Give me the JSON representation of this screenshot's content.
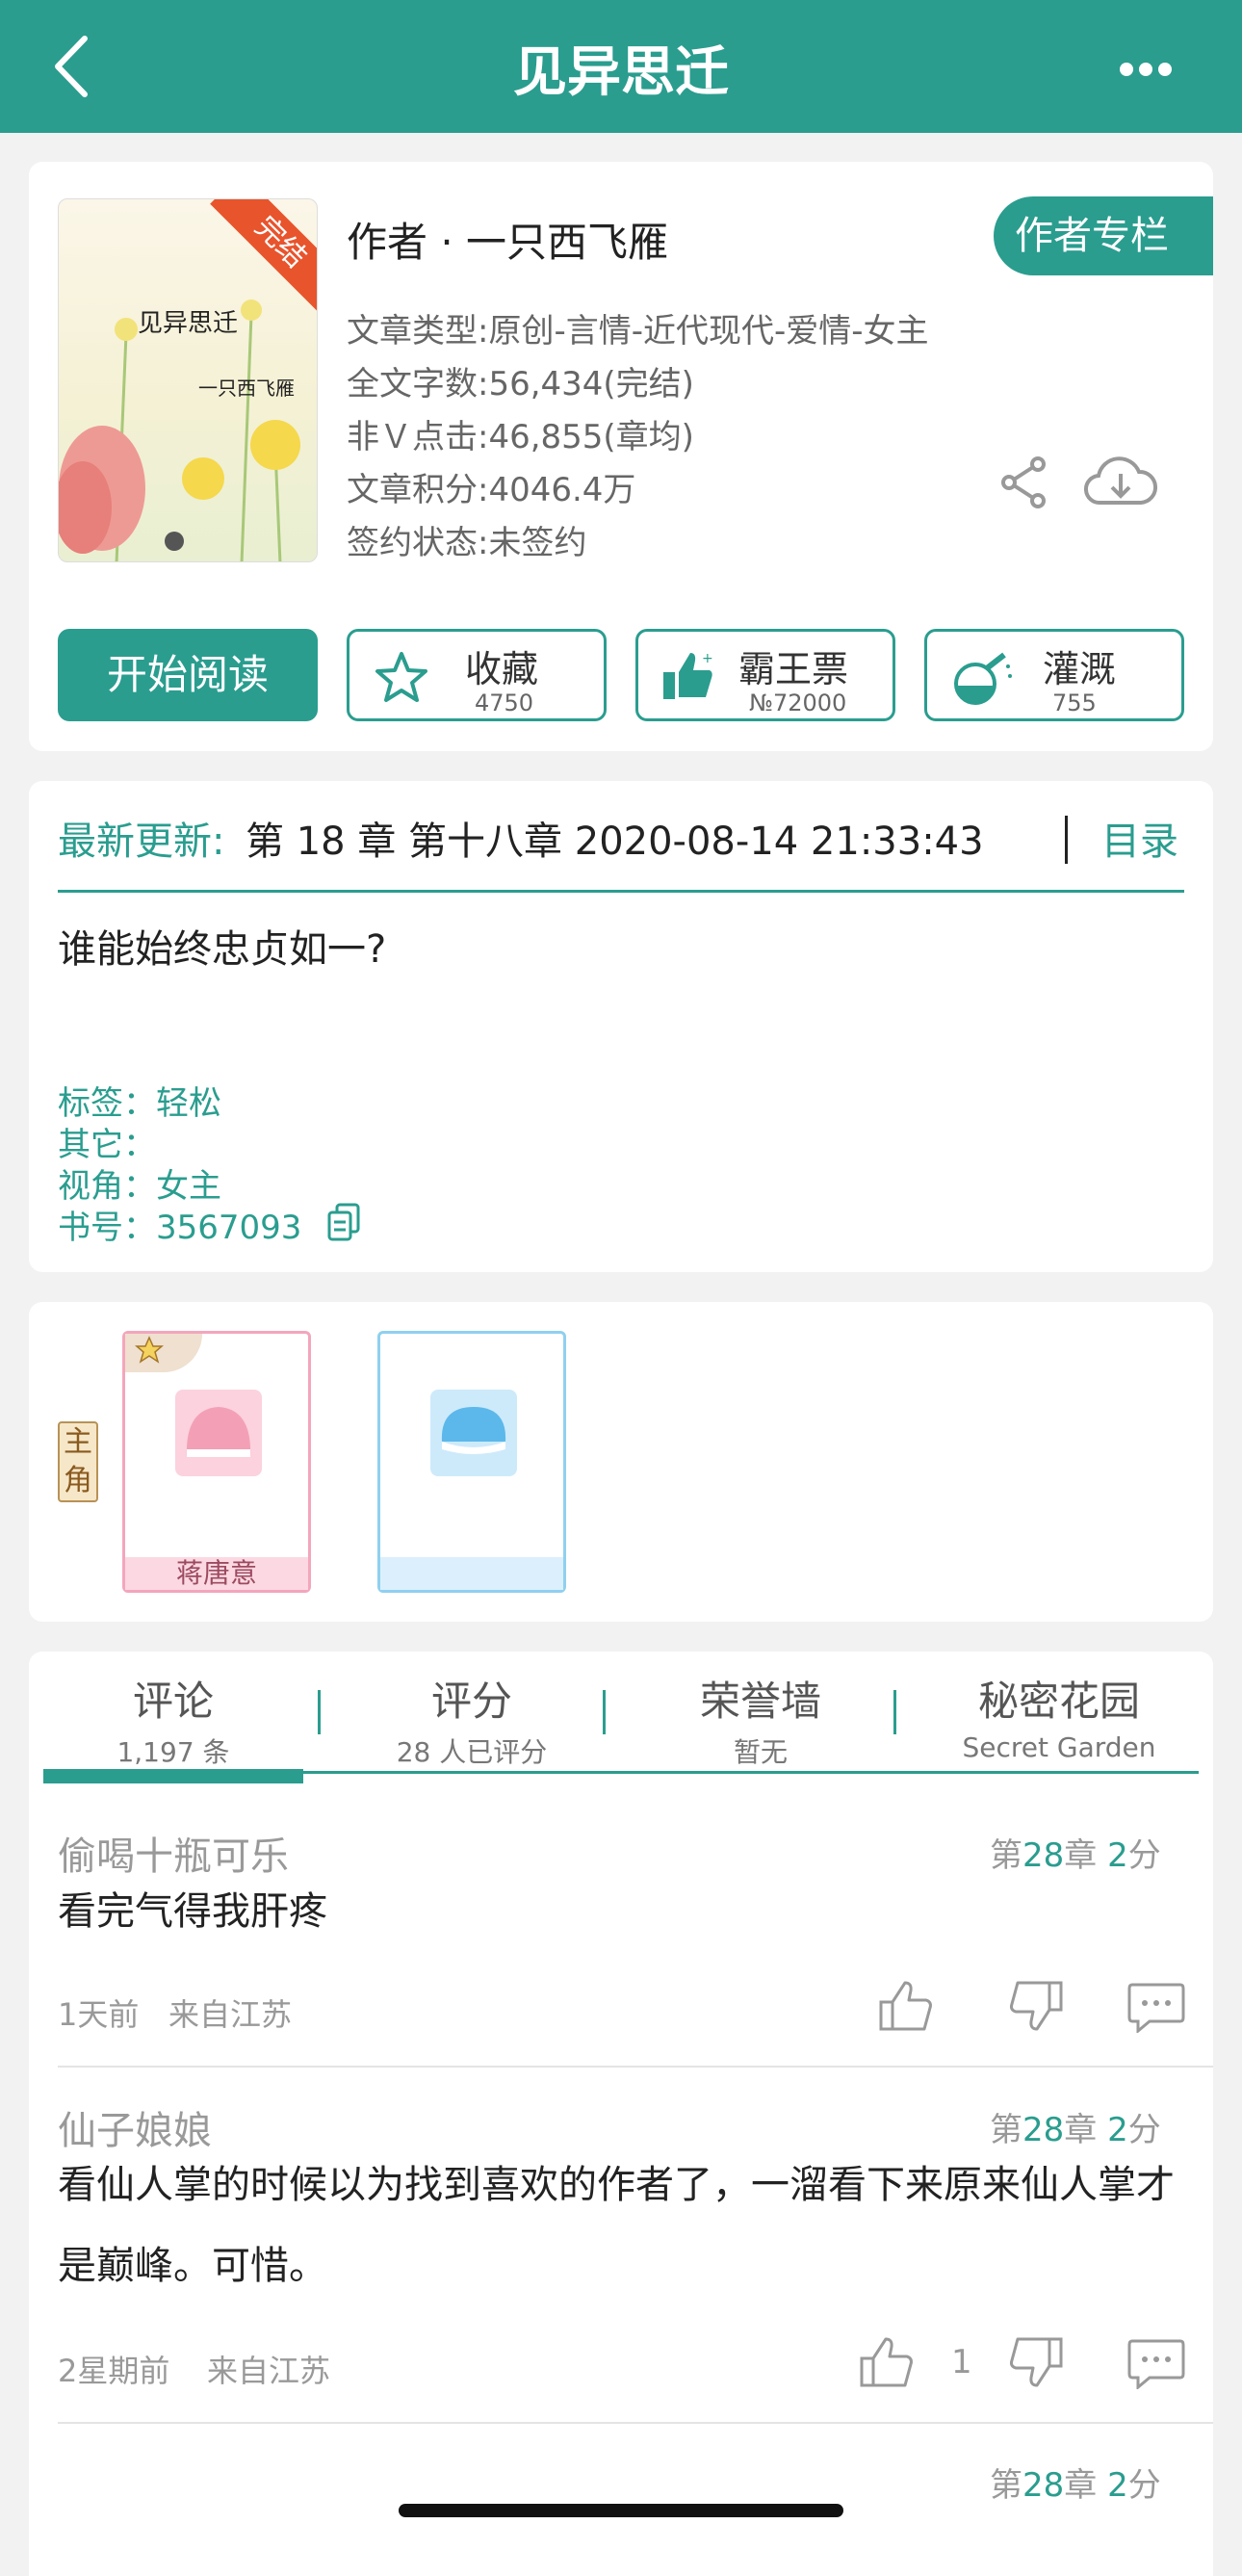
{
  "header": {
    "title": "见异思迁"
  },
  "book": {
    "cover_title": "见异思迁",
    "cover_author": "一只西飞雁",
    "cover_badge": "完结",
    "author_line": "作者 · 一只西飞雁",
    "author_column_button": "作者专栏",
    "genre": "文章类型:原创-言情-近代现代-爱情-女主",
    "word_count": "全文字数:56,434(完结)",
    "clicks": "非Ｖ点击:46,855(章均)",
    "score": "文章积分:4046.4万",
    "sign_status": "签约状态:未签约"
  },
  "actions": {
    "read_button": "开始阅读",
    "favorite": {
      "label": "收藏",
      "count": "4750"
    },
    "vote": {
      "label": "霸王票",
      "count": "№72000"
    },
    "nutrition": {
      "label": "灌溉",
      "count": "755"
    }
  },
  "update": {
    "label": "最新更新:",
    "chapter": "第 18 章  第十八章 2020-08-14 21:33:43",
    "toc": "目录",
    "summary": "谁能始终忠贞如一?",
    "tags_label": "标签：",
    "tags_value": "轻松",
    "other_label": "其它：",
    "pov_label": "视角：",
    "pov_value": "女主",
    "book_no_label": "书号：",
    "book_no_value": "3567093"
  },
  "characters": {
    "role_label": "主角",
    "main_name": "蒋唐意"
  },
  "tabs": [
    {
      "title": "评论",
      "sub": "1,197 条"
    },
    {
      "title": "评分",
      "sub": "28 人已评分"
    },
    {
      "title": "荣誉墙",
      "sub": "暂无"
    },
    {
      "title": "秘密花园",
      "sub": "Secret Garden"
    }
  ],
  "comments": [
    {
      "user": "偷喝十瓶可乐",
      "chapter_prefix": "第",
      "chapter_num": "28",
      "chapter_mid": "章",
      "score_num": "2",
      "score_suffix": "分",
      "body": "看完气得我肝疼",
      "time": "1天前",
      "location": "来自江苏",
      "likes": ""
    },
    {
      "user": "仙子娘娘",
      "chapter_prefix": "第",
      "chapter_num": "28",
      "chapter_mid": "章",
      "score_num": "2",
      "score_suffix": "分",
      "body": "看仙人掌的时候以为找到喜欢的作者了，一溜看下来原来仙人掌才是巅峰。可惜。",
      "time": "2星期前",
      "location": "来自江苏",
      "likes": "1"
    },
    {
      "chapter_prefix": "第",
      "chapter_num": "28",
      "chapter_mid": "章",
      "score_num": "2",
      "score_suffix": "分"
    }
  ],
  "colors": {
    "accent": "#2a9d8f",
    "background": "#f2f2f2"
  }
}
